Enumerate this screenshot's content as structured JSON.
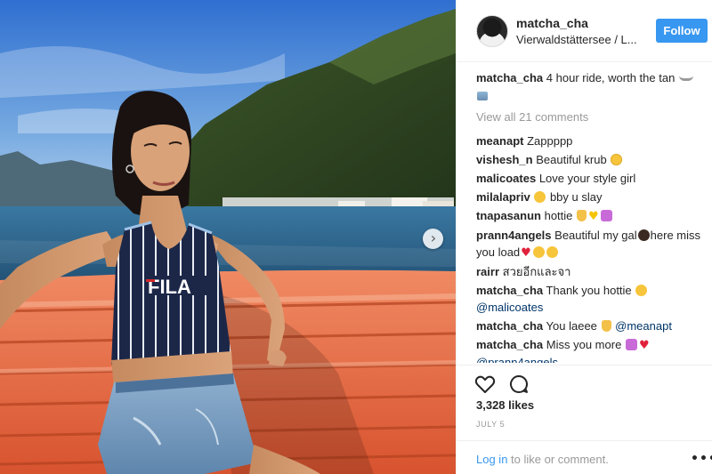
{
  "post": {
    "username": "matcha_cha",
    "location": "Vierwaldstättersee / L...",
    "follow_label": "Follow",
    "caption_user": "matcha_cha",
    "caption_text": "4 hour ride, worth the tan",
    "view_all_label": "View all 21 comments",
    "likes": "3,328 likes",
    "date": "July 5",
    "login_link": "Log in",
    "login_rest": " to like or comment.",
    "more_label": "•••",
    "next_glyph": "›"
  },
  "photo": {
    "shirt_logo": "FILA",
    "colors": {
      "sky": "#5a8fd6",
      "lake": "#2c5f86",
      "bench": "#e5643f",
      "shirt": "#1a2544"
    }
  },
  "comments": [
    {
      "user": "meanapt",
      "text": "Zappppp"
    },
    {
      "user": "vishesh_n",
      "text": "Beautiful krub"
    },
    {
      "user": "malicoates",
      "text": "Love your style girl"
    },
    {
      "user": "milalapriv",
      "text": "bby u slay"
    },
    {
      "user": "tnapasanun",
      "text": "hottie"
    },
    {
      "user": "prann4angels",
      "text": "Beautiful my gal",
      "text2": "here miss you load"
    },
    {
      "user": "rairr",
      "text": "สวยอีกและจา"
    },
    {
      "user": "matcha_cha",
      "text": "Thank you hottie",
      "mention": "@malicoates"
    },
    {
      "user": "matcha_cha",
      "text": "You laeee",
      "mention": "@meanapt"
    },
    {
      "user": "matcha_cha",
      "text": "Miss you more",
      "mention": "@prann4angels"
    }
  ],
  "icons": [
    "heart-icon",
    "comment-icon",
    "chevron-right-icon",
    "ship-emoji",
    "more-icon"
  ]
}
